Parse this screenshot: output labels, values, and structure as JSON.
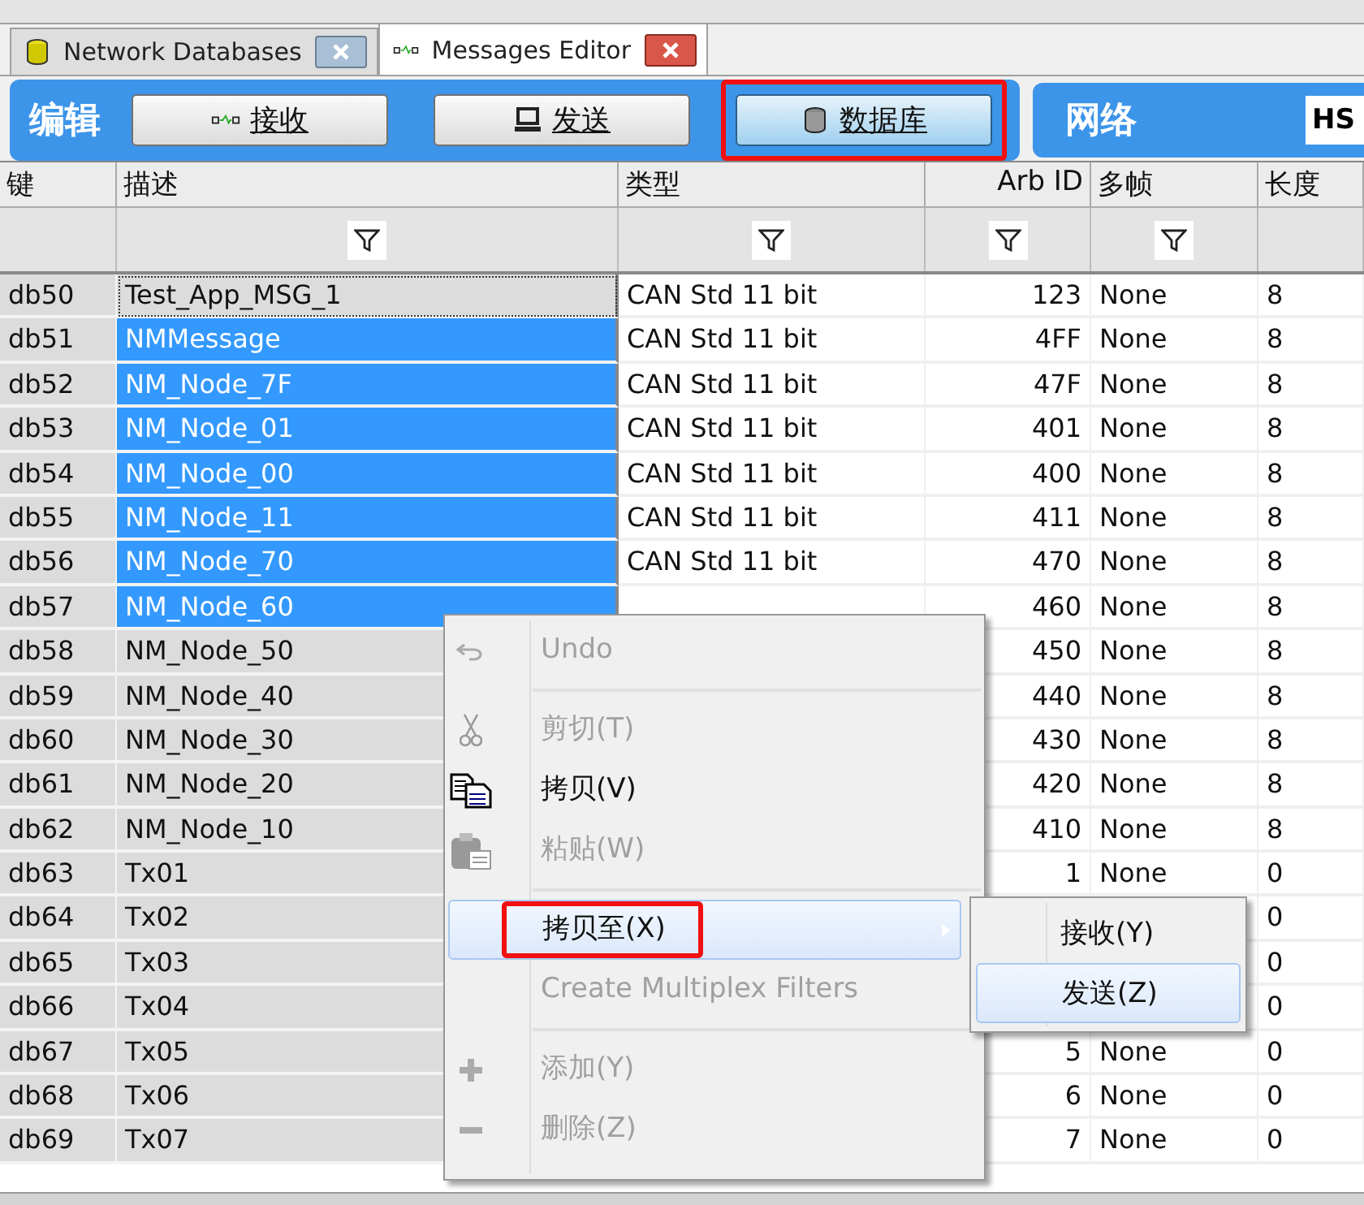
{
  "tabs": [
    {
      "label": "Network Databases",
      "selected": false
    },
    {
      "label": "Messages Editor",
      "selected": true
    }
  ],
  "toolbar": {
    "title": "编辑",
    "buttons": [
      {
        "label": "接收",
        "selected": false,
        "annotated": false
      },
      {
        "label": "发送",
        "selected": false,
        "annotated": false
      },
      {
        "label": "数据库",
        "selected": true,
        "annotated": true
      }
    ],
    "network_label": "网络",
    "network_value": "HS"
  },
  "table": {
    "columns": [
      "键",
      "描述",
      "类型",
      "Arb ID",
      "多帧",
      "长度"
    ],
    "rows": [
      {
        "cells": [
          "db50",
          "Test_App_MSG_1",
          "CAN Std 11 bit",
          "123",
          "None",
          "8"
        ],
        "selected": false,
        "focused": true
      },
      {
        "cells": [
          "db51",
          "NMMessage",
          "CAN Std 11 bit",
          "4FF",
          "None",
          "8"
        ],
        "selected": true,
        "focused": false
      },
      {
        "cells": [
          "db52",
          "NM_Node_7F",
          "CAN Std 11 bit",
          "47F",
          "None",
          "8"
        ],
        "selected": true,
        "focused": false
      },
      {
        "cells": [
          "db53",
          "NM_Node_01",
          "CAN Std 11 bit",
          "401",
          "None",
          "8"
        ],
        "selected": true,
        "focused": false
      },
      {
        "cells": [
          "db54",
          "NM_Node_00",
          "CAN Std 11 bit",
          "400",
          "None",
          "8"
        ],
        "selected": true,
        "focused": false
      },
      {
        "cells": [
          "db55",
          "NM_Node_11",
          "CAN Std 11 bit",
          "411",
          "None",
          "8"
        ],
        "selected": true,
        "focused": false
      },
      {
        "cells": [
          "db56",
          "NM_Node_70",
          "CAN Std 11 bit",
          "470",
          "None",
          "8"
        ],
        "selected": true,
        "focused": false
      },
      {
        "cells": [
          "db57",
          "NM_Node_60",
          null,
          "460",
          "None",
          "8"
        ],
        "selected": true,
        "focused": false
      },
      {
        "cells": [
          "db58",
          "NM_Node_50",
          null,
          "450",
          "None",
          "8"
        ],
        "selected": false,
        "focused": false
      },
      {
        "cells": [
          "db59",
          "NM_Node_40",
          null,
          "440",
          "None",
          "8"
        ],
        "selected": false,
        "focused": false
      },
      {
        "cells": [
          "db60",
          "NM_Node_30",
          null,
          "430",
          "None",
          "8"
        ],
        "selected": false,
        "focused": false
      },
      {
        "cells": [
          "db61",
          "NM_Node_20",
          null,
          "420",
          "None",
          "8"
        ],
        "selected": false,
        "focused": false
      },
      {
        "cells": [
          "db62",
          "NM_Node_10",
          null,
          "410",
          "None",
          "8"
        ],
        "selected": false,
        "focused": false
      },
      {
        "cells": [
          "db63",
          "Tx01",
          null,
          "1",
          "None",
          "0"
        ],
        "selected": false,
        "focused": false
      },
      {
        "cells": [
          "db64",
          "Tx02",
          null,
          null,
          null,
          "0"
        ],
        "selected": false,
        "focused": false
      },
      {
        "cells": [
          "db65",
          "Tx03",
          null,
          null,
          null,
          "0"
        ],
        "selected": false,
        "focused": false
      },
      {
        "cells": [
          "db66",
          "Tx04",
          null,
          null,
          null,
          "0"
        ],
        "selected": false,
        "focused": false
      },
      {
        "cells": [
          "db67",
          "Tx05",
          null,
          "5",
          "None",
          "0"
        ],
        "selected": false,
        "focused": false
      },
      {
        "cells": [
          "db68",
          "Tx06",
          null,
          "6",
          "None",
          "0"
        ],
        "selected": false,
        "focused": false
      },
      {
        "cells": [
          "db69",
          "Tx07",
          null,
          "7",
          "None",
          "0"
        ],
        "selected": false,
        "focused": false
      }
    ]
  },
  "context_menu": {
    "items": [
      {
        "kind": "item",
        "label": "Undo",
        "disabled": true,
        "selected": false,
        "annotated": false
      },
      {
        "kind": "separator"
      },
      {
        "kind": "item",
        "label": "剪切(T)",
        "disabled": true,
        "selected": false,
        "annotated": false
      },
      {
        "kind": "item",
        "label": "拷贝(V)",
        "disabled": false,
        "selected": false,
        "annotated": false
      },
      {
        "kind": "item",
        "label": "粘贴(W)",
        "disabled": true,
        "selected": false,
        "annotated": false
      },
      {
        "kind": "separator"
      },
      {
        "kind": "submenu",
        "label": "拷贝至(X)",
        "disabled": false,
        "selected": true,
        "annotated": true
      },
      {
        "kind": "item",
        "label": "Create Multiplex Filters",
        "disabled": true,
        "selected": false,
        "annotated": false
      },
      {
        "kind": "separator"
      },
      {
        "kind": "item",
        "label": "添加(Y)",
        "disabled": true,
        "selected": false,
        "annotated": false
      },
      {
        "kind": "item",
        "label": "删除(Z)",
        "disabled": true,
        "selected": false,
        "annotated": false
      }
    ],
    "submenu": [
      {
        "label": "接收(Y)",
        "selected": false
      },
      {
        "label": "发送(Z)",
        "selected": true
      }
    ]
  }
}
